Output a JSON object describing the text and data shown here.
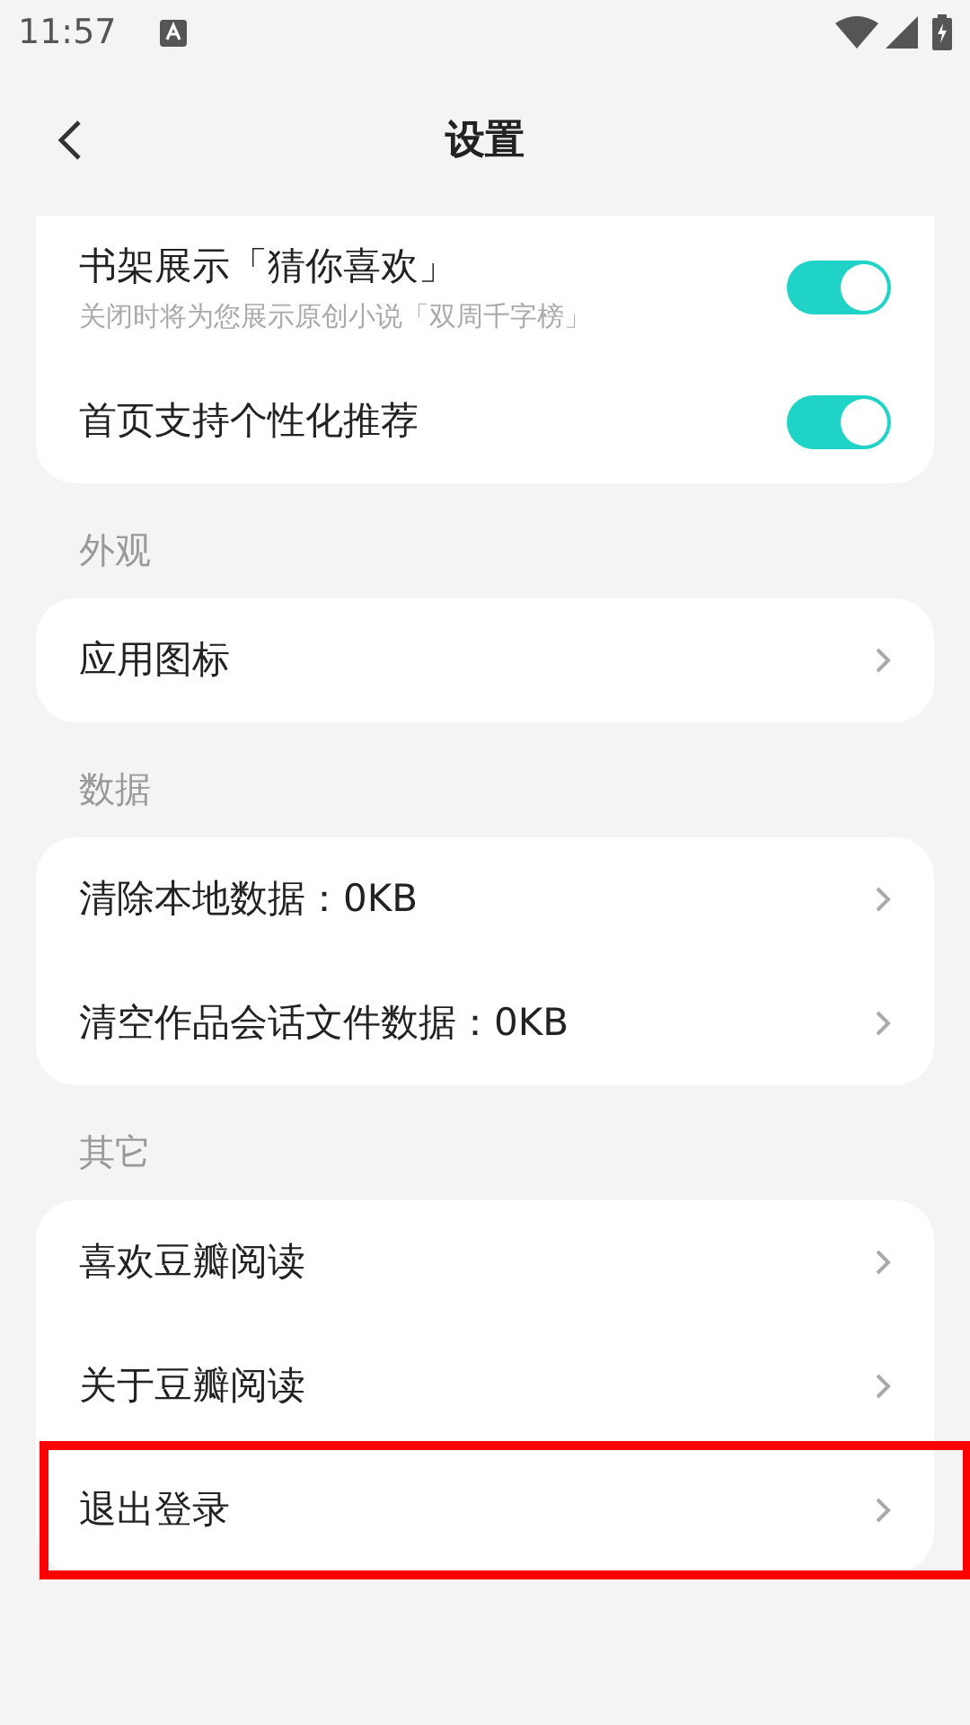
{
  "status_bar": {
    "time": "11:57"
  },
  "header": {
    "title": "设置"
  },
  "groups": [
    {
      "items": [
        {
          "kind": "toggle",
          "label": "书架展示「猜你喜欢」",
          "subtitle": "关闭时将为您展示原创小说「双周千字榜」",
          "on": true,
          "highlighted": false
        },
        {
          "kind": "toggle",
          "label": "首页支持个性化推荐",
          "on": true,
          "highlighted": false
        }
      ]
    },
    {
      "title": "外观",
      "items": [
        {
          "kind": "link",
          "label": "应用图标",
          "highlighted": false
        }
      ]
    },
    {
      "title": "数据",
      "items": [
        {
          "kind": "link",
          "label": "清除本地数据：0KB",
          "highlighted": false
        },
        {
          "kind": "link",
          "label": "清空作品会话文件数据：0KB",
          "highlighted": false
        }
      ]
    },
    {
      "title": "其它",
      "items": [
        {
          "kind": "link",
          "label": "喜欢豆瓣阅读",
          "highlighted": false
        },
        {
          "kind": "link",
          "label": "关于豆瓣阅读",
          "highlighted": false
        },
        {
          "kind": "link",
          "label": "退出登录",
          "highlighted": true
        }
      ]
    }
  ]
}
